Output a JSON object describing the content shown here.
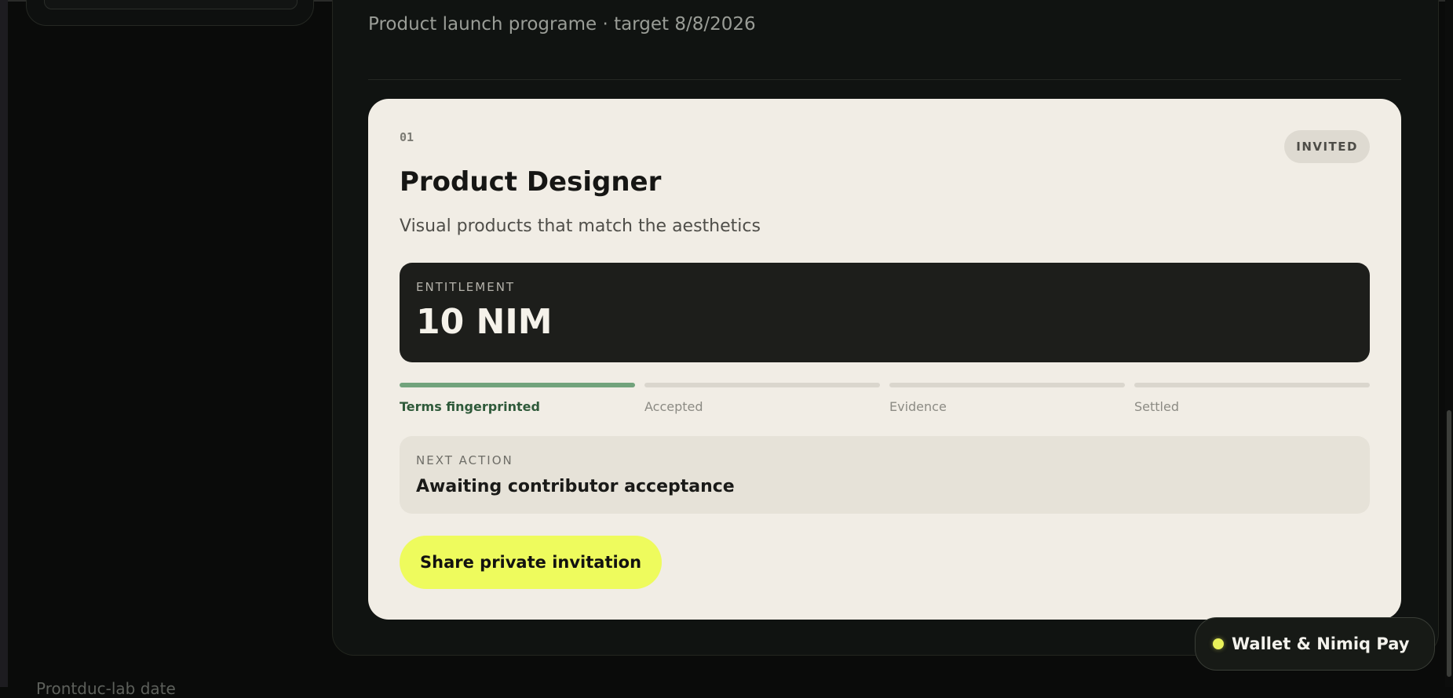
{
  "programme": {
    "subtitle": "Product launch programe · target 8/8/2026"
  },
  "role_card": {
    "index": "01",
    "status": "INVITED",
    "title": "Product Designer",
    "description": "Visual products that match the aesthetics",
    "entitlement": {
      "label": "ENTITLEMENT",
      "value": "10 NIM"
    },
    "steps": [
      {
        "label": "Terms fingerprinted",
        "active": true
      },
      {
        "label": "Accepted",
        "active": false
      },
      {
        "label": "Evidence",
        "active": false
      },
      {
        "label": "Settled",
        "active": false
      }
    ],
    "next_action": {
      "label": "NEXT ACTION",
      "value": "Awaiting contributor acceptance"
    },
    "share_button": "Share private invitation"
  },
  "wallet": {
    "label": "Wallet & Nimiq Pay",
    "status_color": "#e9f25a"
  },
  "sidebar": {
    "footer_text": "Prontduc-lab date"
  },
  "colors": {
    "accent": "#eefb5d",
    "progress_active": "#72a37c",
    "card_bg": "#f1ede5"
  }
}
